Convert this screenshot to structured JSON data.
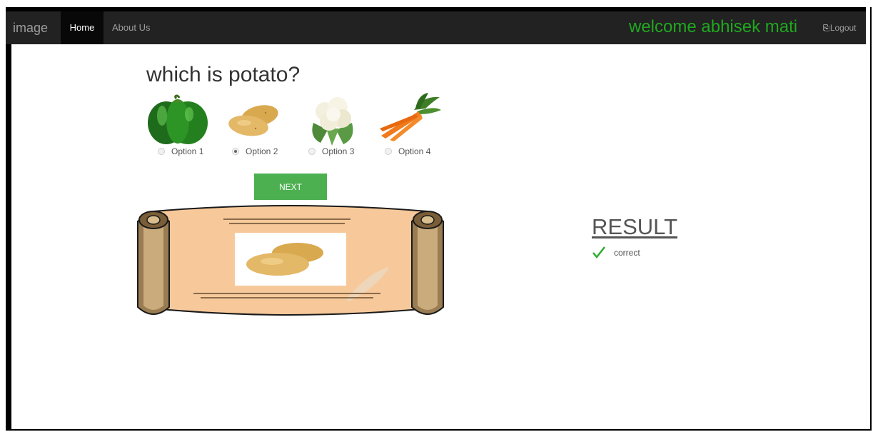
{
  "navbar": {
    "brand": "image",
    "items": [
      {
        "label": "Home",
        "active": true
      },
      {
        "label": "About Us",
        "active": false
      }
    ],
    "welcome": "welcome abhisek mati",
    "logout_label": "Logout",
    "logout_icon": "sign-out-icon"
  },
  "quiz": {
    "question": "which is potato?",
    "options": [
      {
        "label": "Option 1",
        "image": "green-bell-pepper",
        "selected": false
      },
      {
        "label": "Option 2",
        "image": "potatoes",
        "selected": true
      },
      {
        "label": "Option 3",
        "image": "cauliflower",
        "selected": false
      },
      {
        "label": "Option 4",
        "image": "carrots",
        "selected": false
      }
    ],
    "next_label": "NEXT"
  },
  "info_scroll": {
    "image": "potatoes-photo"
  },
  "result": {
    "title": "RESULT",
    "status": "correct",
    "icon": "checkmark-icon"
  },
  "colors": {
    "navbar_bg": "#222222",
    "welcome_text": "#1fa81f",
    "next_button": "#4caf50",
    "check_mark": "#2eaa2e",
    "scroll_paper": "#f7c99a"
  }
}
